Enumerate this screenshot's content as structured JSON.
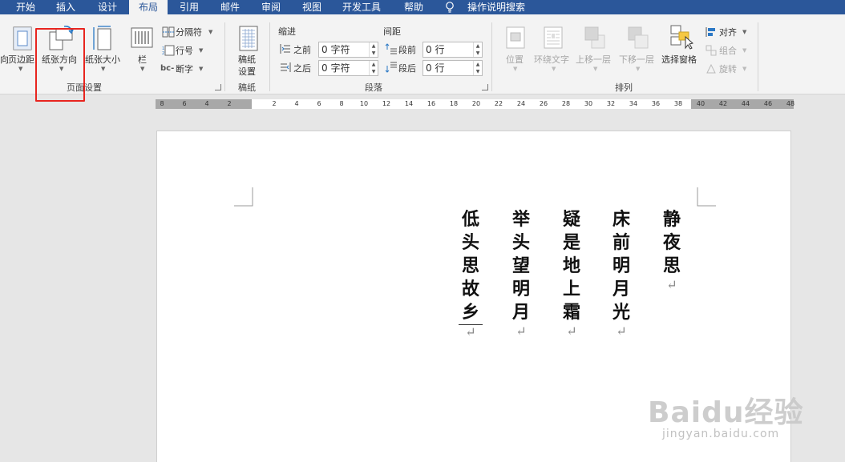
{
  "tabs": [
    {
      "label": "开始",
      "active": false
    },
    {
      "label": "插入",
      "active": false
    },
    {
      "label": "设计",
      "active": false
    },
    {
      "label": "布局",
      "active": true
    },
    {
      "label": "引用",
      "active": false
    },
    {
      "label": "邮件",
      "active": false
    },
    {
      "label": "审阅",
      "active": false
    },
    {
      "label": "视图",
      "active": false
    },
    {
      "label": "开发工具",
      "active": false
    },
    {
      "label": "帮助",
      "active": false
    }
  ],
  "help_search": "操作说明搜索",
  "page_setup": {
    "cut_label": "向",
    "margins": "页边距",
    "orientation": "纸张方向",
    "size": "纸张大小",
    "columns": "栏",
    "breaks": "分隔符",
    "line_numbers": "行号",
    "hyphenation": "断字",
    "group": "页面设置"
  },
  "manuscript": {
    "button_line1": "稿纸",
    "button_line2": "设置",
    "group": "稿纸"
  },
  "paragraph": {
    "indent_header": "缩进",
    "spacing_header": "间距",
    "indent_before_label": "之前",
    "indent_before_value": "0 字符",
    "indent_after_label": "之后",
    "indent_after_value": "0 字符",
    "space_before_label": "段前",
    "space_before_value": "0 行",
    "space_after_label": "段后",
    "space_after_value": "0 行",
    "group": "段落"
  },
  "arrange": {
    "position": "位置",
    "wrap_text": "环绕文字",
    "bring_forward": "上移一层",
    "send_backward": "下移一层",
    "selection_pane": "选择窗格",
    "align": "对齐",
    "group_btn": "组合",
    "rotate": "旋转",
    "group": "排列"
  },
  "ruler_numbers": [
    "8",
    "6",
    "4",
    "2",
    "2",
    "4",
    "6",
    "8",
    "10",
    "12",
    "14",
    "16",
    "18",
    "20",
    "22",
    "24",
    "26",
    "28",
    "30",
    "32",
    "34",
    "36",
    "38",
    "40",
    "42",
    "44",
    "46",
    "48"
  ],
  "poem": {
    "title": "静夜思",
    "line1": "床前明月光",
    "line2": "疑是地上霜",
    "line3": "举头望明月",
    "line4": "低头思故乡",
    "paragraph_mark": "↵"
  },
  "watermark": {
    "brand": "Baidu经验",
    "url": "jingyan.baidu.com"
  },
  "colors": {
    "tab_bar": "#2b579a",
    "highlight": "#e8251f"
  }
}
